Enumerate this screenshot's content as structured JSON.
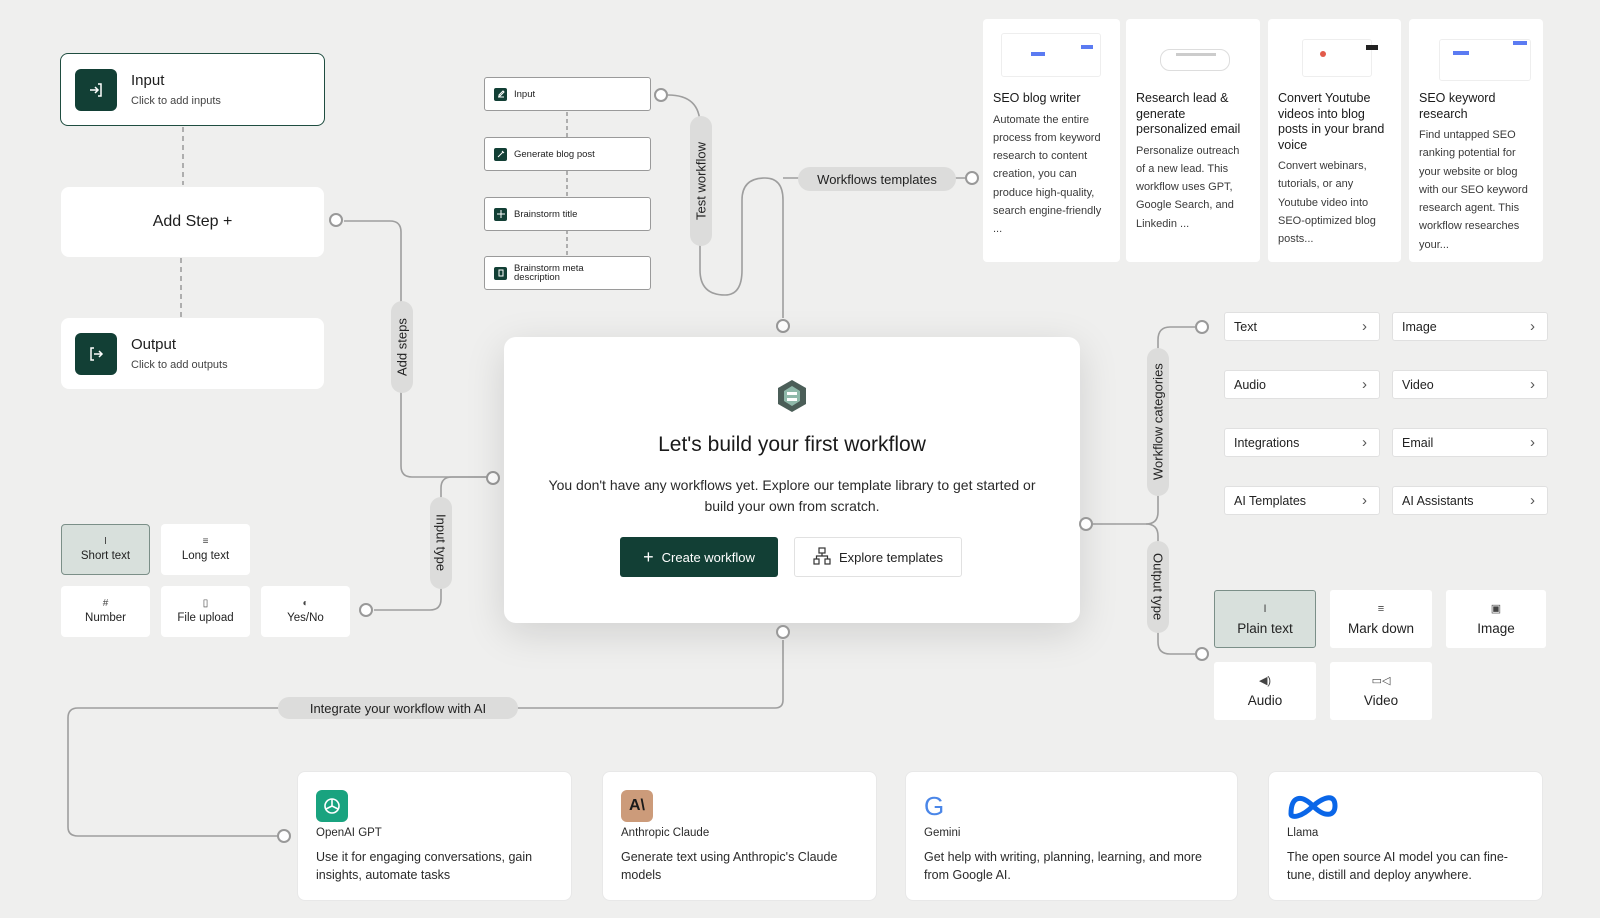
{
  "steps": {
    "input": {
      "title": "Input",
      "subtitle": "Click to add inputs"
    },
    "add_step": {
      "label": "Add Step +"
    },
    "output": {
      "title": "Output",
      "subtitle": "Click to add outputs"
    }
  },
  "connector_labels": {
    "add_steps": "Add steps",
    "test_workflow": "Test workflow",
    "workflows_templates": "Workflows templates",
    "input_type": "Input type",
    "workflow_categories": "Workflow categories",
    "output_type": "Output type",
    "integrate_ai": "Integrate your workflow with AI"
  },
  "mini_workflow": [
    {
      "label": "Input",
      "icon": "edit-icon"
    },
    {
      "label": "Generate blog post",
      "icon": "pen-icon"
    },
    {
      "label": "Brainstorm title",
      "icon": "sparkle-icon"
    },
    {
      "label": "Brainstorm meta description",
      "icon": "doc-icon"
    }
  ],
  "input_types": [
    {
      "label": "Short text",
      "icon": "I",
      "selected": true
    },
    {
      "label": "Long text",
      "icon": "≡",
      "selected": false
    },
    {
      "label": "Number",
      "icon": "#",
      "selected": false
    },
    {
      "label": "File upload",
      "icon": "▯",
      "selected": false
    },
    {
      "label": "Yes/No",
      "icon": "◐",
      "selected": false
    }
  ],
  "main": {
    "title": "Let's build your first workflow",
    "description": "You don't have any workflows yet. Explore our template library to get started or build your own from scratch.",
    "create_label": "Create workflow",
    "explore_label": "Explore templates"
  },
  "templates": [
    {
      "title": "SEO blog writer",
      "description": "Automate the entire process from keyword research to content creation, you can produce high-quality, search engine-friendly ..."
    },
    {
      "title": "Research lead & generate personalized email",
      "description": "Personalize outreach of a new lead. This workflow uses GPT, Google Search, and Linkedin ..."
    },
    {
      "title": "Convert Youtube videos into blog posts in your brand voice",
      "description": "Convert webinars, tutorials, or any Youtube video into SEO-optimized blog posts..."
    },
    {
      "title": "SEO keyword research",
      "description": "Find untapped SEO ranking potential for your website or blog with our SEO keyword research agent. This workflow researches your..."
    }
  ],
  "categories": [
    {
      "label": "Text"
    },
    {
      "label": "Image"
    },
    {
      "label": "Audio"
    },
    {
      "label": "Video"
    },
    {
      "label": "Integrations"
    },
    {
      "label": "Email"
    },
    {
      "label": "AI Templates"
    },
    {
      "label": "AI Assistants"
    }
  ],
  "output_types": [
    {
      "label": "Plain text",
      "icon": "I",
      "selected": true
    },
    {
      "label": "Mark down",
      "icon": "≡",
      "selected": false
    },
    {
      "label": "Image",
      "icon": "▣",
      "selected": false
    },
    {
      "label": "Audio",
      "icon": "◀)",
      "selected": false
    },
    {
      "label": "Video",
      "icon": "▭◁",
      "selected": false
    }
  ],
  "providers": [
    {
      "name": "OpenAI GPT",
      "description": "Use it for engaging conversations, gain insights, automate tasks",
      "color": "#19a37f"
    },
    {
      "name": "Anthropic Claude",
      "description": "Generate text using Anthropic's Claude models",
      "color": "#cc9b7a",
      "logo_text": "A\\"
    },
    {
      "name": "Gemini",
      "description": "Get help with writing, planning, learning, and more from Google AI.",
      "logo_text": "G"
    },
    {
      "name": "Llama",
      "description": "The open source AI model you can fine-tune, distill and deploy anywhere.",
      "color": "#0a66e8",
      "logo_text": "∞"
    }
  ],
  "colors": {
    "brand": "#123f35",
    "background": "#efefee",
    "selected": "#d8e0dc"
  }
}
